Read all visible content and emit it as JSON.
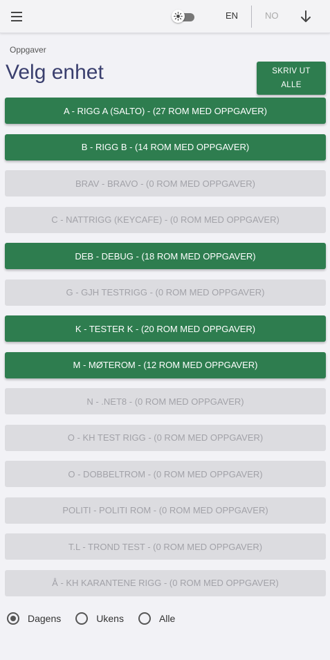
{
  "topbar": {
    "menu_icon": "hamburger-menu-icon",
    "theme_icon": "sun-icon",
    "lang_en": "EN",
    "lang_no": "NO",
    "download_icon": "arrow-down-icon"
  },
  "breadcrumb": "Oppgaver",
  "page_title": "Velg enhet",
  "print_button": {
    "line1": "SKRIV UT",
    "line2": "ALLE"
  },
  "units": [
    {
      "label": "A - RIGG A (SALTO) - (27 ROM MED OPPGAVER)",
      "active": true
    },
    {
      "label": "B - RIGG B - (14 ROM MED OPPGAVER)",
      "active": true
    },
    {
      "label": "BRAV - BRAVO - (0 ROM MED OPPGAVER)",
      "active": false
    },
    {
      "label": "C - NATTRIGG (KEYCAFE) - (0 ROM MED OPPGAVER)",
      "active": false
    },
    {
      "label": "DEB - DEBUG - (18 ROM MED OPPGAVER)",
      "active": true
    },
    {
      "label": "G - GJH TESTRIGG - (0 ROM MED OPPGAVER)",
      "active": false
    },
    {
      "label": "K - TESTER K - (20 ROM MED OPPGAVER)",
      "active": true
    },
    {
      "label": "M - MØTEROM - (12 ROM MED OPPGAVER)",
      "active": true
    },
    {
      "label": "N - .NET8 - (0 ROM MED OPPGAVER)",
      "active": false
    },
    {
      "label": "O - KH TEST RIGG - (0 ROM MED OPPGAVER)",
      "active": false
    },
    {
      "label": "O - DOBBELTROM - (0 ROM MED OPPGAVER)",
      "active": false
    },
    {
      "label": "POLITI - POLITI ROM - (0 ROM MED OPPGAVER)",
      "active": false
    },
    {
      "label": "T.L - TROND TEST - (0 ROM MED OPPGAVER)",
      "active": false
    },
    {
      "label": "Å - KH KARANTENE RIGG - (0 ROM MED OPPGAVER)",
      "active": false
    }
  ],
  "period_filter": {
    "options": [
      "Dagens",
      "Ukens",
      "Alle"
    ],
    "selected": "Dagens"
  },
  "colors": {
    "active_unit": "#2e7d4f",
    "inactive_unit": "#dcdce0",
    "title": "#3a3f6e"
  }
}
